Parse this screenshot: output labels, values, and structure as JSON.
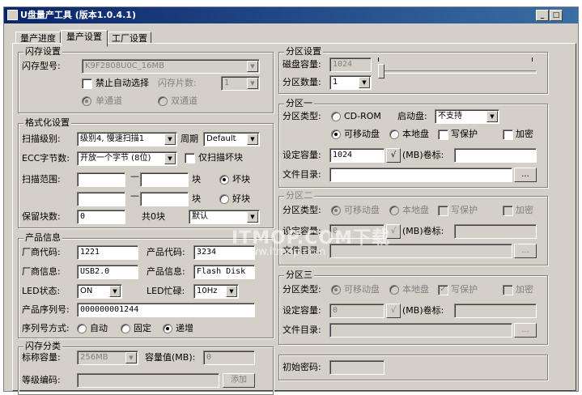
{
  "window": {
    "title": "U盘量产工具 (版本1.0.4.1)",
    "min": "_",
    "max": "□",
    "close": "×"
  },
  "tabs": [
    "量产进度",
    "量产设置",
    "工厂设置"
  ],
  "flash": {
    "title": "闪存设置",
    "model_label": "闪存型号:",
    "model_value": "K9F2808U0C_16MB",
    "disable_auto": "禁止自动选择",
    "chips_label": "闪存片数:",
    "chips_value": "1",
    "single": "单通道",
    "dual": "双通道"
  },
  "format": {
    "title": "格式化设置",
    "scan_label": "扫描级别:",
    "scan_value": "级别4, 慢速扫描1",
    "cycle_label": "周期",
    "cycle_value": "Default",
    "ecc_label": "ECC字节数:",
    "ecc_value": "开放一个字节 (8位)",
    "bad_only": "仅扫描坏块",
    "range_label": "扫描范围:",
    "block1": "块",
    "block2": "块",
    "bad_block": "坏块",
    "good_block": "好块",
    "reserve_label": "保留块数:",
    "reserve_value": "0",
    "total_label": "共0块",
    "default_value": "默认"
  },
  "product": {
    "title": "产品信息",
    "vendor_code_label": "厂商代码:",
    "vendor_code": "1221",
    "product_code_label": "产品代码:",
    "product_code": "3234",
    "vendor_info_label": "厂商信息:",
    "vendor_info": "USB2.0",
    "product_info_label": "产品信息:",
    "product_info": "Flash Disk",
    "led_label": "LED状态:",
    "led_value": "ON",
    "led_busy_label": "LED忙碌:",
    "led_busy_value": "10Hz",
    "serial_label": "产品序列号:",
    "serial_value": "000000001244",
    "serial_mode_label": "序列号方式:",
    "auto": "自动",
    "fixed": "固定",
    "increment": "递增"
  },
  "flash_class": {
    "title": "闪存分类",
    "nominal_label": "标称容量:",
    "nominal_value": "256MB",
    "cap_label": "容量值(MB):",
    "cap_value": "0",
    "grade_label": "等级编码:",
    "add": "添加"
  },
  "partition": {
    "title": "分区设置",
    "disk_cap_label": "磁盘容量:",
    "disk_cap_value": "1024",
    "count_label": "分区数量:",
    "count_value": "1"
  },
  "p1": {
    "title": "分区一",
    "type_label": "分区类型:",
    "cdrom": "CD-ROM",
    "boot_label": "启动盘:",
    "boot_value": "不支持",
    "removable": "可移动盘",
    "local": "本地盘",
    "wp": "写保护",
    "encrypt": "加密",
    "cap_label": "设定容量:",
    "cap_value": "1024",
    "check": "√",
    "mb_label": "(MB)卷标:",
    "dir_label": "文件目录:",
    "browse": "..."
  },
  "p2": {
    "title": "分区二",
    "type_label": "分区类型:",
    "removable": "可移动盘",
    "local": "本地盘",
    "wp": "写保护",
    "encrypt": "加密",
    "cap_label": "设定容量:",
    "cap_value": "0",
    "check": "√",
    "mb_label": "(MB)卷标:",
    "dir_label": "文件目录:",
    "browse": "..."
  },
  "p3": {
    "title": "分区三",
    "type_label": "分区类型:",
    "removable": "可移动盘",
    "local": "本地盘",
    "wp": "写保护",
    "encrypt": "加密",
    "cap_label": "设定容量:",
    "cap_value": "0",
    "check": "√",
    "mb_label": "(MB)卷标:",
    "dir_label": "文件目录:",
    "browse": "..."
  },
  "init_pw": {
    "label": "初始密码:"
  },
  "watermark": {
    "line1": "ITMOP.COM下载",
    "line2": "www.itmop.com"
  }
}
